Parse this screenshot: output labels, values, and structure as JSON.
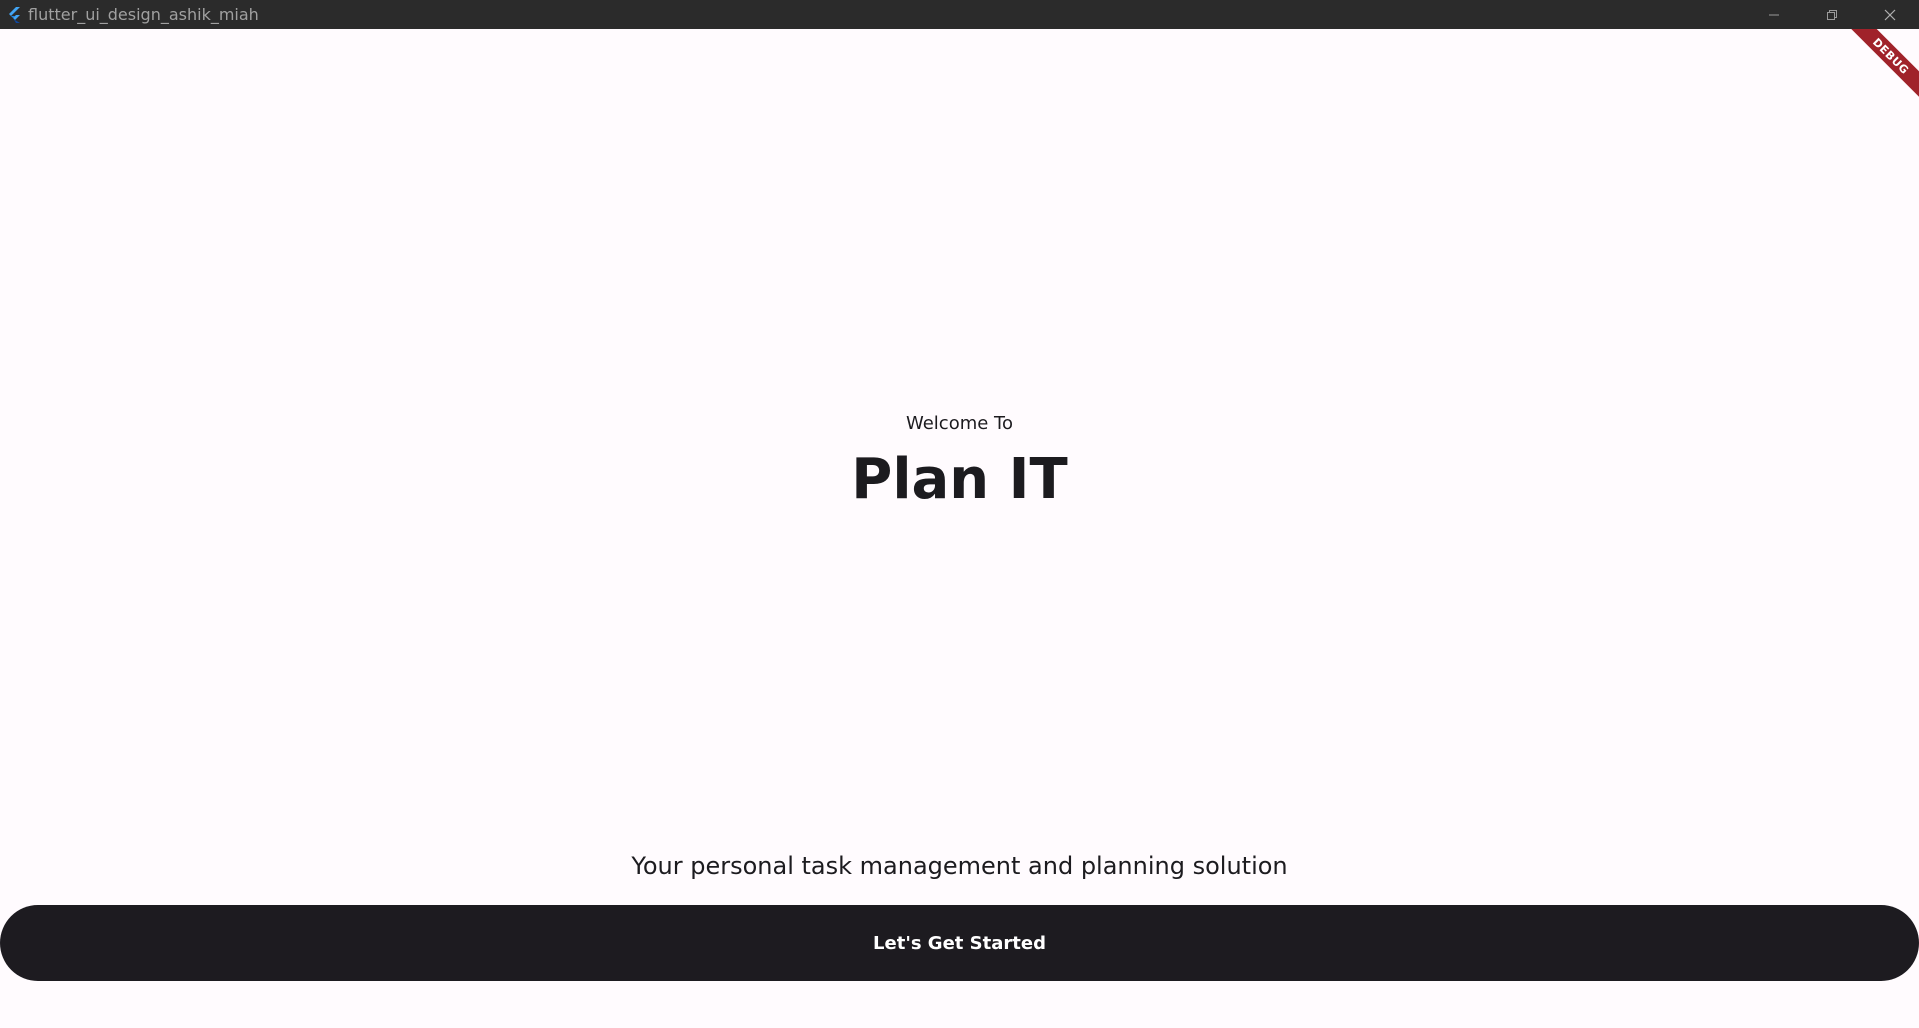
{
  "window": {
    "title": "flutter_ui_design_ashik_miah",
    "icon": "flutter-logo-icon",
    "controls": [
      "minimize-icon",
      "restore-icon",
      "close-icon"
    ]
  },
  "debug_banner": {
    "label": "DEBUG",
    "color": "#a0222a"
  },
  "splash": {
    "welcome": "Welcome To",
    "app_name": "Plan IT",
    "tagline": "Your personal task management and planning solution",
    "button_label": "Let's Get Started"
  },
  "colors": {
    "background": "#fffbfe",
    "titlebar": "#2b2b2b",
    "text": "#1c1b1f",
    "button": "#1d1b20",
    "button_text": "#ffffff"
  }
}
